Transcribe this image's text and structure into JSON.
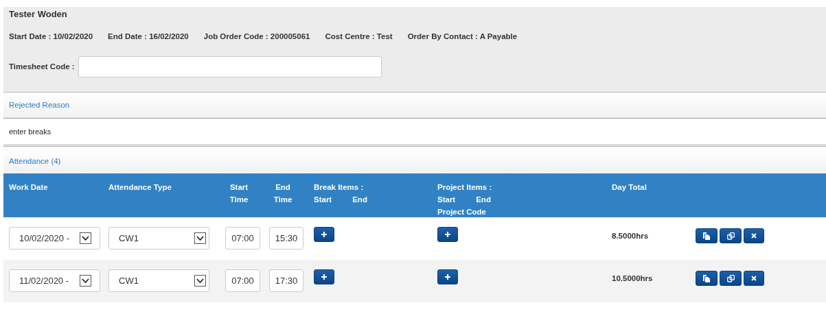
{
  "header": {
    "name": "Tester Woden",
    "details": [
      "Start Date : 10/02/2020",
      "End Date : 16/02/2020",
      "Job Order Code : 200005061",
      "Cost Centre : Test",
      "Order By Contact : A Payable"
    ],
    "timesheet_code": {
      "label": "Timesheet Code :"
    }
  },
  "rejected": {
    "title": "Rejected Reason",
    "text": "enter breaks"
  },
  "attendance": {
    "title": "Attendance (4)",
    "columns": [
      {
        "label": "Work Date"
      },
      {
        "label": "Attendance Type"
      },
      {
        "label": "Start Time"
      },
      {
        "label": "End Time"
      },
      {
        "label": "Break Items :",
        "sub": [
          "Start",
          "End"
        ]
      },
      {
        "label": "Project Items :",
        "sub": [
          "Start",
          "End"
        ],
        "footer": "Project Code"
      },
      {
        "label": "Day Total"
      }
    ],
    "rows": [
      {
        "work_date": "10/02/2020 -",
        "attendance_type": "CW1",
        "start_time": "07:00",
        "end_time": "15:30",
        "day_total": "8.5000hrs"
      },
      {
        "work_date": "11/02/2020 -",
        "attendance_type": "CW1",
        "start_time": "07:00",
        "end_time": "17:30",
        "day_total": "10.5000hrs"
      }
    ]
  }
}
